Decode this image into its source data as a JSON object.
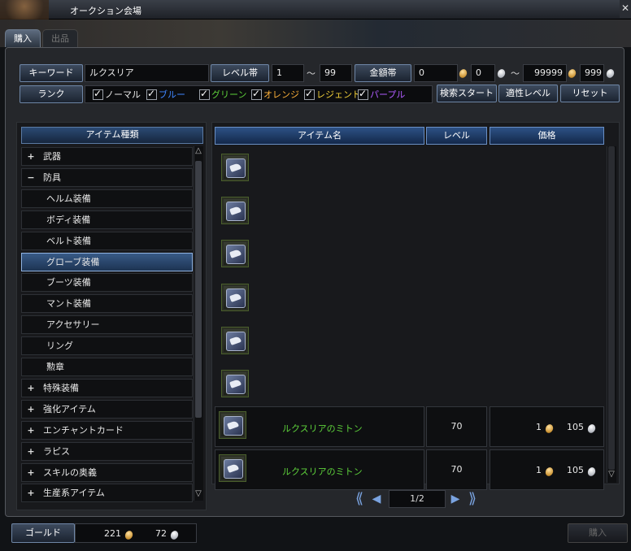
{
  "window": {
    "title": "オークション会場",
    "close_glyph": "✕"
  },
  "tabs": [
    {
      "label": "購入"
    },
    {
      "label": "出品"
    }
  ],
  "search": {
    "keyword_label": "キーワード",
    "keyword_value": "ルクスリア",
    "level_label": "レベル帯",
    "level_min": "1",
    "tilde": "～",
    "level_max": "99",
    "price_label": "金額帯",
    "price_min_gold": "0",
    "price_min_silver": "0",
    "price_max_gold": "99999",
    "price_max_silver": "999",
    "rank_label": "ランク",
    "ranks": [
      {
        "label": "ノーマル",
        "color": "#e8e8e8"
      },
      {
        "label": "ブルー",
        "color": "#3f86ff"
      },
      {
        "label": "グリーン",
        "color": "#5ed23b"
      },
      {
        "label": "オレンジ",
        "color": "#ffb23a"
      },
      {
        "label": "レジェンド",
        "color": "#f5d33a"
      },
      {
        "label": "パープル",
        "color": "#b05cff"
      }
    ],
    "start_label": "検索スタート",
    "suitable_label": "適性レベル",
    "reset_label": "リセット"
  },
  "categories": {
    "header": "アイテム種類",
    "items": [
      {
        "label": "武器",
        "expander": "+",
        "indent": 0
      },
      {
        "label": "防具",
        "expander": "−",
        "indent": 0
      },
      {
        "label": "ヘルム装備",
        "expander": "",
        "indent": 1
      },
      {
        "label": "ボディ装備",
        "expander": "",
        "indent": 1
      },
      {
        "label": "ベルト装備",
        "expander": "",
        "indent": 1
      },
      {
        "label": "グローブ装備",
        "expander": "",
        "indent": 1,
        "selected": true
      },
      {
        "label": "ブーツ装備",
        "expander": "",
        "indent": 1
      },
      {
        "label": "マント装備",
        "expander": "",
        "indent": 1
      },
      {
        "label": "アクセサリー",
        "expander": "",
        "indent": 1
      },
      {
        "label": "リング",
        "expander": "",
        "indent": 1
      },
      {
        "label": "勲章",
        "expander": "",
        "indent": 1
      },
      {
        "label": "特殊装備",
        "expander": "+",
        "indent": 0
      },
      {
        "label": "強化アイテム",
        "expander": "+",
        "indent": 0
      },
      {
        "label": "エンチャントカード",
        "expander": "+",
        "indent": 0
      },
      {
        "label": "ラピス",
        "expander": "+",
        "indent": 0
      },
      {
        "label": "スキルの奥義",
        "expander": "+",
        "indent": 0
      },
      {
        "label": "生産系アイテム",
        "expander": "+",
        "indent": 0
      }
    ]
  },
  "table": {
    "headers": {
      "name": "アイテム名",
      "level": "レベル",
      "price": "価格"
    },
    "icon_only_rows": 6,
    "rows": [
      {
        "name": "ルクスリアのミトン",
        "level": "70",
        "gold": "1",
        "silver": "105"
      },
      {
        "name": "ルクスリアのミトン",
        "level": "70",
        "gold": "1",
        "silver": "105"
      }
    ]
  },
  "pagination": {
    "first": "⟪",
    "prev": "◀",
    "page": "1/2",
    "next": "▶",
    "last": "⟫"
  },
  "footer": {
    "gold_label": "ゴールド",
    "gold": "221",
    "silver": "72",
    "buy_label": "購入"
  }
}
